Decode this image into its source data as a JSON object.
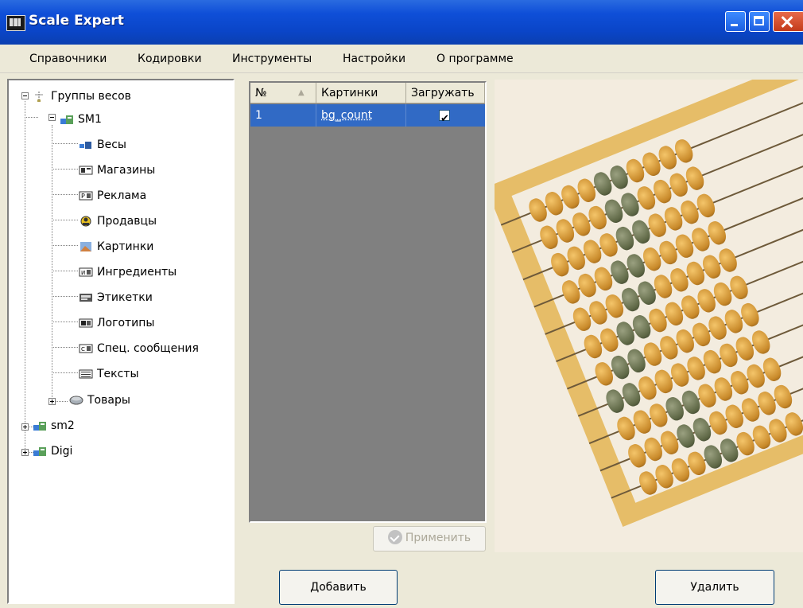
{
  "window": {
    "title": "Scale Expert"
  },
  "menu": [
    "Справочники",
    "Кодировки",
    "Инструменты",
    "Настройки",
    "О программе"
  ],
  "tree": {
    "root": "Группы весов",
    "groups": [
      {
        "label": "SM1",
        "expanded": true,
        "children": [
          "Весы",
          "Магазины",
          "Реклама",
          "Продавцы",
          "Картинки",
          "Ингредиенты",
          "Этикетки",
          "Логотипы",
          "Спец. сообщения",
          "Тексты",
          "Товары"
        ]
      },
      {
        "label": "sm2",
        "expanded": false
      },
      {
        "label": "Digi",
        "expanded": false
      }
    ]
  },
  "grid": {
    "columns": [
      "№",
      "Картинки",
      "Загружать"
    ],
    "rows": [
      {
        "num": "1",
        "picture": "bg_count",
        "load": true
      }
    ]
  },
  "buttons": {
    "apply": "Применить",
    "add": "Добавить",
    "delete": "Удалить"
  },
  "icons": {
    "apply": "check-circle-icon",
    "tree_root": "scale-group-icon",
    "group": "scale-group-icon"
  }
}
